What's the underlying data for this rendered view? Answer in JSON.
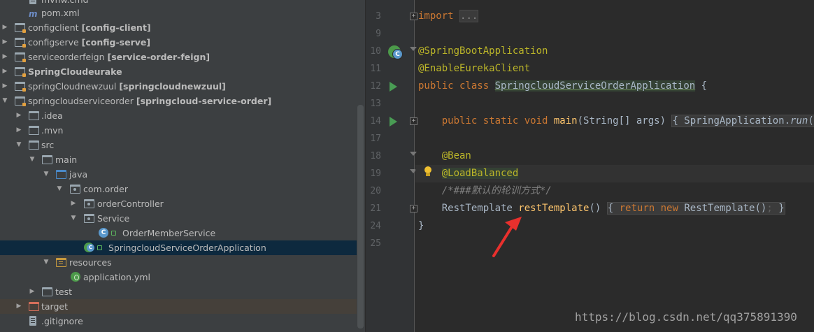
{
  "tree": {
    "items": [
      {
        "label": "mvnw.cmd",
        "module": ""
      },
      {
        "label": "pom.xml",
        "module": ""
      },
      {
        "label": "configclient",
        "module": "[config-client]"
      },
      {
        "label": "configserve",
        "module": "[config-serve]"
      },
      {
        "label": "serviceorderfeign",
        "module": "[service-order-feign]"
      },
      {
        "label": "SpringCloudeurake",
        "module": ""
      },
      {
        "label": "springCloudnewzuul",
        "module": "[springcloudnewzuul]"
      },
      {
        "label": "springcloudserviceorder",
        "module": "[springcloud-service-order]"
      },
      {
        "label": ".idea",
        "module": ""
      },
      {
        "label": ".mvn",
        "module": ""
      },
      {
        "label": "src",
        "module": ""
      },
      {
        "label": "main",
        "module": ""
      },
      {
        "label": "java",
        "module": ""
      },
      {
        "label": "com.order",
        "module": ""
      },
      {
        "label": "orderController",
        "module": ""
      },
      {
        "label": "Service",
        "module": ""
      },
      {
        "label": "OrderMemberService",
        "module": ""
      },
      {
        "label": "SpringcloudServiceOrderApplication",
        "module": ""
      },
      {
        "label": "resources",
        "module": ""
      },
      {
        "label": "application.yml",
        "module": ""
      },
      {
        "label": "test",
        "module": ""
      },
      {
        "label": "target",
        "module": ""
      },
      {
        "label": ".gitignore",
        "module": ""
      }
    ],
    "selected": "SpringcloudServiceOrderApplication",
    "class_icon_letter": "C",
    "pom_icon_letter": "m"
  },
  "editor": {
    "line_numbers": [
      "3",
      "9",
      "10",
      "11",
      "12",
      "13",
      "14",
      "17",
      "18",
      "19",
      "20",
      "21",
      "24",
      "25"
    ],
    "code": {
      "l3_kw": "import",
      "l3_fold": "...",
      "l10_ann": "@SpringBootApplication",
      "l11_ann": "@EnableEurekaClient",
      "l12_kw": "public class",
      "l12_name": "SpringcloudServiceOrderApplication",
      "l12_brace": " {",
      "l14_kw": "public static void",
      "l14_fn": "main",
      "l14_args": "(String[] args) ",
      "l14_fold": "{ SpringApplication.",
      "l14_run": "run",
      "l14_rest": "(Spri",
      "l18_ann": "@Bean",
      "l19_ann": "@LoadBalanced",
      "l20_cmt": "/*###默认的轮训方式*/",
      "l21_type": "RestTemplate ",
      "l21_fn": "restTemplate",
      "l21_paren": "() ",
      "l21_f1": "{ ",
      "l21_ret": "return new",
      "l21_new": " RestTemplate()",
      "l21_semi": ";",
      "l21_close": " }",
      "l24_brace": "}"
    },
    "spring_icon_letter": "C"
  },
  "watermark": "https://blog.csdn.net/qq375891390",
  "colors": {
    "tree_bg": "#3c3f41",
    "editor_bg": "#2b2b2b",
    "keyword": "#cc7832",
    "annotation": "#bbb529",
    "method": "#ffc66d",
    "arrow": "#e8302d"
  }
}
